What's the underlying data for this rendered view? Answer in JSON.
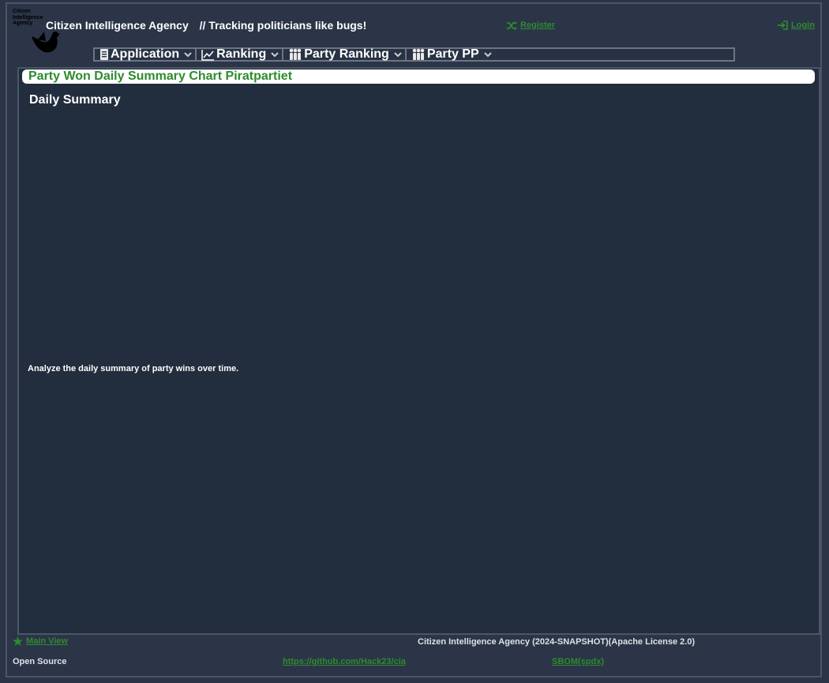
{
  "header": {
    "logo_text": "Citizen Intelligence Agency",
    "brand_name": "Citizen Intelligence Agency",
    "tagline": "// Tracking politicians like bugs!",
    "register_label": "Register",
    "login_label": "Login",
    "register_icon": "shuffle-icon",
    "login_icon": "sign-in-icon"
  },
  "menu": {
    "items": [
      {
        "label": "Application",
        "icon": "document-icon"
      },
      {
        "label": "Ranking",
        "icon": "line-chart-icon"
      },
      {
        "label": "Party Ranking",
        "icon": "group-icon"
      },
      {
        "label": "Party PP",
        "icon": "group-icon"
      }
    ]
  },
  "page": {
    "title": "Party Won Daily Summary Chart Piratpartiet",
    "section_title": "Daily Summary",
    "description": "Analyze the daily summary of party wins over time."
  },
  "footer": {
    "main_view_label": "Main View",
    "main_view_icon": "star-icon",
    "copyright": "Citizen Intelligence Agency (2024-SNAPSHOT)(Apache License 2.0)",
    "open_source_label": "Open Source",
    "github_link": "https://github.com/Hack23/cia",
    "sbom_link": "SBOM(spdx)"
  },
  "colors": {
    "background": "#2b3547",
    "content_bg": "#222d3e",
    "accent_green": "#2e8b2e",
    "text": "#ffffff"
  }
}
